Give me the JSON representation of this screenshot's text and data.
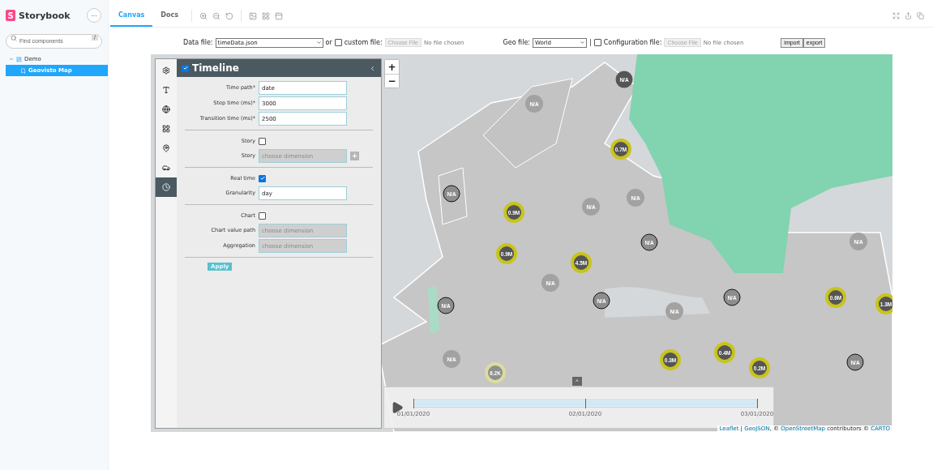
{
  "sidebar": {
    "brand": {
      "mark": "S",
      "name": "Storybook"
    },
    "menu_button": "···",
    "search": {
      "placeholder": "Find components",
      "shortcut": "/"
    },
    "tree": [
      {
        "label": "Demo",
        "expanded": true,
        "selected": false,
        "children": [
          {
            "label": "Geovisto Map",
            "selected": true
          }
        ]
      }
    ]
  },
  "toolbar": {
    "tabs": [
      {
        "label": "Canvas",
        "selected": true
      },
      {
        "label": "Docs",
        "selected": false
      }
    ]
  },
  "file_bar": {
    "data_file": {
      "label": "Data file:",
      "value": "timeData.json"
    },
    "or": "or",
    "custom_file": {
      "checked": false,
      "label": "custom file:",
      "button": "Choose File",
      "status": "No file chosen"
    },
    "geo_file": {
      "label": "Geo file:",
      "value": "World"
    },
    "separator": "|",
    "config_file": {
      "checked": false,
      "label": "Configuration file:",
      "button": "Choose File",
      "status": "No file chosen"
    },
    "buttons": [
      "import",
      "export"
    ]
  },
  "map": {
    "zoom_in": "+",
    "zoom_out": "−",
    "markers": [
      {
        "kind": "dark",
        "text": "N/A"
      },
      {
        "kind": "faint",
        "text": "N/A"
      },
      {
        "kind": "ring",
        "text": "0.7M"
      },
      {
        "kind": "outline",
        "text": "N/A"
      },
      {
        "kind": "ring",
        "text": "0.9M"
      },
      {
        "kind": "faint",
        "text": "N/A"
      },
      {
        "kind": "faint",
        "text": "N/A"
      },
      {
        "kind": "outline",
        "text": "N/A"
      },
      {
        "kind": "ring",
        "text": "0.9M"
      },
      {
        "kind": "ring",
        "text": "4.5M"
      },
      {
        "kind": "faint",
        "text": "N/A"
      },
      {
        "kind": "faint",
        "text": "N/A"
      },
      {
        "kind": "outline",
        "text": "N/A"
      },
      {
        "kind": "outline",
        "text": "N/A"
      },
      {
        "kind": "faint",
        "text": "N/A"
      },
      {
        "kind": "outline",
        "text": "N/A"
      },
      {
        "kind": "ring",
        "text": "0.6M"
      },
      {
        "kind": "ring",
        "text": "1.3M"
      },
      {
        "kind": "faint",
        "text": "N/A"
      },
      {
        "kind": "ring",
        "text": "0.3M"
      },
      {
        "kind": "ring",
        "text": "0.4M"
      },
      {
        "kind": "ring",
        "text": "0.2M"
      },
      {
        "kind": "outline",
        "text": "N/A"
      },
      {
        "kind": "pale",
        "text": "6.2K"
      }
    ],
    "player": {
      "toggle": "^",
      "ticks": [
        "01/01/2020",
        "02/01/2020",
        "03/01/2020"
      ],
      "level": 1
    },
    "attribution": [
      {
        "text": "Leaflet",
        "kind": "link"
      },
      {
        "text": " | ",
        "kind": "text"
      },
      {
        "text": "GeoJSON",
        "kind": "link"
      },
      {
        "text": ", © ",
        "kind": "text"
      },
      {
        "text": "OpenStreetMap",
        "kind": "link"
      },
      {
        "text": " contributors © ",
        "kind": "text"
      },
      {
        "text": "CARTO",
        "kind": "link"
      }
    ]
  },
  "panel": {
    "tabs": [
      {
        "kind": "settings",
        "selected": false
      },
      {
        "kind": "text",
        "selected": false
      },
      {
        "kind": "globe",
        "selected": false
      },
      {
        "kind": "grid",
        "selected": false
      },
      {
        "kind": "pin",
        "selected": false
      },
      {
        "kind": "car",
        "selected": false
      },
      {
        "kind": "clock",
        "selected": true
      }
    ],
    "header": {
      "checked": true,
      "title": "Timeline"
    },
    "sections": [
      [
        {
          "kind": "text",
          "label": "Time path*",
          "value": "date"
        },
        {
          "kind": "text",
          "label": "Step time (ms)*",
          "value": "3000"
        },
        {
          "kind": "text",
          "label": "Transition time (ms)*",
          "value": "2500"
        }
      ],
      [
        {
          "kind": "checkbox",
          "label": "Story",
          "checked": false
        },
        {
          "kind": "select",
          "label": "Story",
          "placeholder": "choose dimension",
          "add": "+"
        }
      ],
      [
        {
          "kind": "checkbox",
          "label": "Real time",
          "checked": true
        },
        {
          "kind": "text",
          "label": "Granularity",
          "value": "day"
        }
      ],
      [
        {
          "kind": "checkbox",
          "label": "Chart",
          "checked": false
        },
        {
          "kind": "select",
          "label": "Chart value path",
          "placeholder": "choose dimension"
        },
        {
          "kind": "select",
          "label": "Aggregation",
          "placeholder": "choose dimension"
        }
      ]
    ],
    "apply": "Apply"
  }
}
